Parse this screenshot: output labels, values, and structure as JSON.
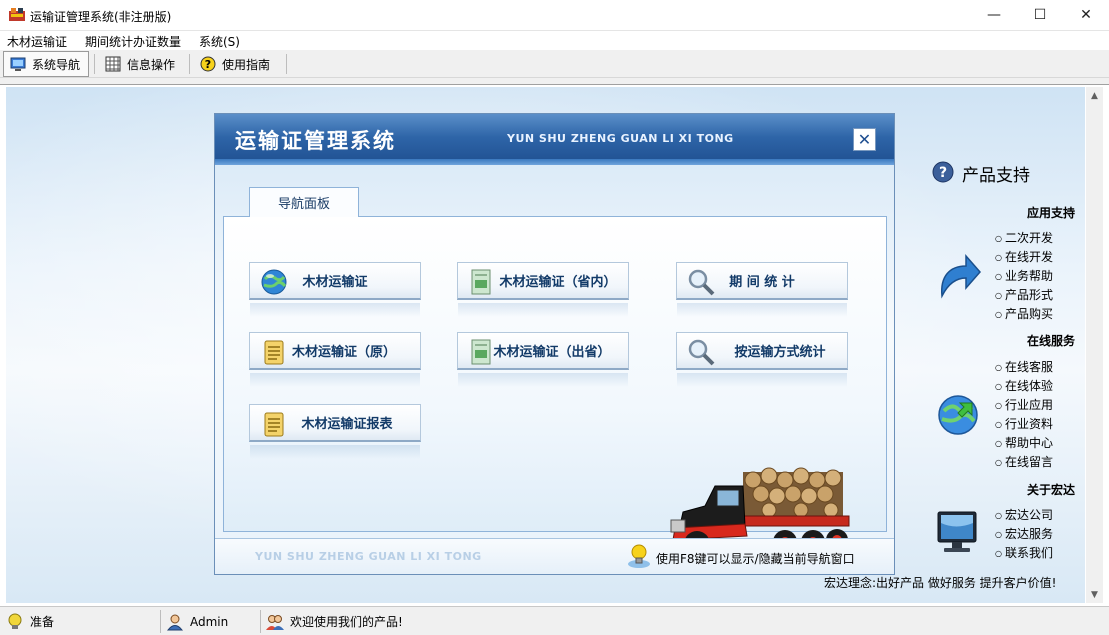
{
  "window": {
    "title": "运输证管理系统(非注册版)",
    "minimize_glyph": "—",
    "maximize_glyph": "☐",
    "close_glyph": "✕"
  },
  "menu": [
    "木材运输证",
    "期间统计办证数量",
    "系统(S)"
  ],
  "toolbar": {
    "items": [
      {
        "label": "系统导航",
        "icon": "monitor-icon"
      },
      {
        "label": "信息操作",
        "icon": "grid-icon"
      },
      {
        "label": "使用指南",
        "icon": "help-icon"
      }
    ]
  },
  "dialog": {
    "title": "运输证管理系统",
    "pinyin": "YUN SHU ZHENG GUAN LI XI TONG",
    "close_glyph": "✕",
    "tab_label": "导航面板",
    "buttons": [
      {
        "label": "木材运输证",
        "icon": "globe-icon"
      },
      {
        "label": "木材运输证（省内）",
        "icon": "document-icon"
      },
      {
        "label": "期 间 统 计",
        "icon": "magnifier-icon"
      },
      {
        "label": "木材运输证（原）",
        "icon": "notepad-icon"
      },
      {
        "label": "木材运输证（出省）",
        "icon": "document-icon"
      },
      {
        "label": "按运输方式统计",
        "icon": "magnifier-icon"
      },
      {
        "label": "木材运输证报表",
        "icon": "notepad-icon"
      }
    ],
    "footer_pinyin": "YUN SHU ZHENG GUAN LI XI TONG",
    "footer_hint": "使用F8键可以显示/隐藏当前导航窗口"
  },
  "side": {
    "title": "产品支持",
    "sections": [
      {
        "heading": "应用支持",
        "links": [
          "二次开发",
          "在线开发",
          "业务帮助",
          "产品形式",
          "产品购买"
        ]
      },
      {
        "heading": "在线服务",
        "links": [
          "在线客服",
          "在线体验",
          "行业应用",
          "行业资料",
          "帮助中心",
          "在线留言"
        ]
      },
      {
        "heading": "关于宏达",
        "links": [
          "宏达公司",
          "宏达服务",
          "联系我们"
        ]
      }
    ],
    "motto": "宏达理念:出好产品 做好服务 提升客户价值!"
  },
  "status": {
    "ready": "准备",
    "user": "Admin",
    "welcome": "欢迎使用我们的产品!"
  },
  "colors": {
    "header_blue": "#2e65a8",
    "button_text": "#123a68",
    "truck_red": "#d8281d"
  }
}
